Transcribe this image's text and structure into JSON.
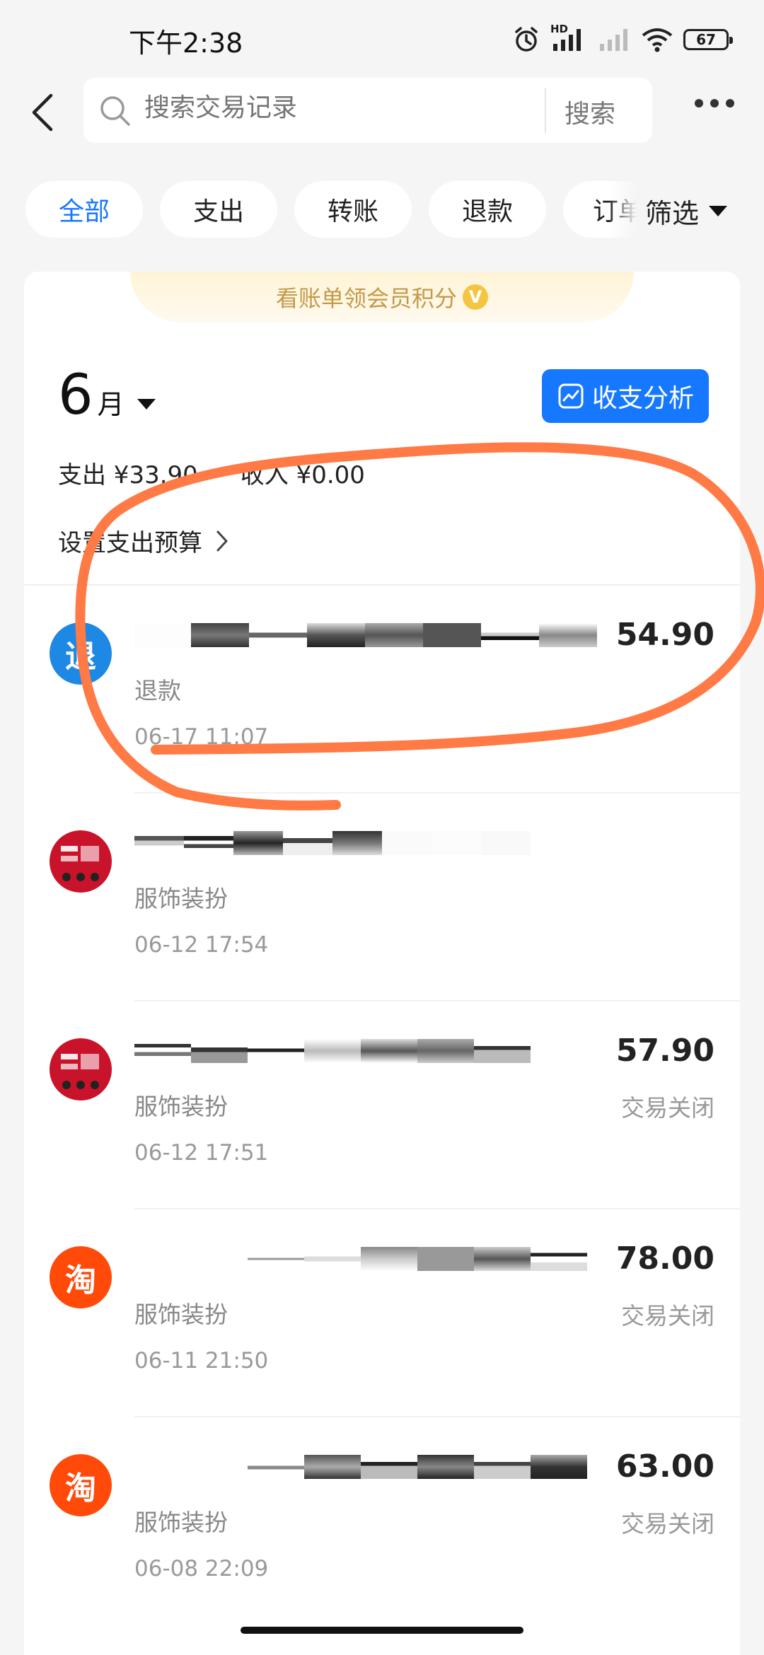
{
  "status_bar": {
    "time": "下午2:38",
    "hd_label": "HD",
    "battery": "67",
    "icons": [
      "alarm-icon",
      "signal-icon",
      "signal-off-icon",
      "wifi-icon",
      "battery-icon"
    ]
  },
  "header": {
    "back_icon": "chevron-left-icon",
    "search_placeholder": "搜索交易记录",
    "search_button": "搜索",
    "more_icon": "more-icon"
  },
  "filters": {
    "chips": [
      "全部",
      "支出",
      "转账",
      "退款",
      "订单"
    ],
    "active_chip": "全部",
    "filter_label": "筛选"
  },
  "banner": {
    "text": "看账单领会员积分",
    "icon_label": "V"
  },
  "summary": {
    "month_num": "6",
    "month_unit": "月",
    "analysis_button": "收支分析",
    "expense": "支出 ¥33.90",
    "income": "收入 ¥0.00",
    "budget": "设置支出预算"
  },
  "transactions": [
    {
      "avatar": "退",
      "category": "退款",
      "time": "06-17 11:07",
      "amount": "54.90",
      "status": ""
    },
    {
      "avatar": "tmall",
      "category": "服饰装扮",
      "time": "06-12 17:54",
      "amount": "",
      "status": ""
    },
    {
      "avatar": "tmall",
      "category": "服饰装扮",
      "time": "06-12 17:51",
      "amount": "57.90",
      "status": "交易关闭"
    },
    {
      "avatar": "淘",
      "category": "服饰装扮",
      "time": "06-11 21:50",
      "amount": "78.00",
      "status": "交易关闭"
    },
    {
      "avatar": "淘",
      "category": "服饰装扮",
      "time": "06-08 22:09",
      "amount": "63.00",
      "status": "交易关闭"
    }
  ],
  "colors": {
    "accent": "#1677ff",
    "annotation": "#ff7a45",
    "taobao": "#ff4a0a",
    "tmall": "#c9132b"
  }
}
